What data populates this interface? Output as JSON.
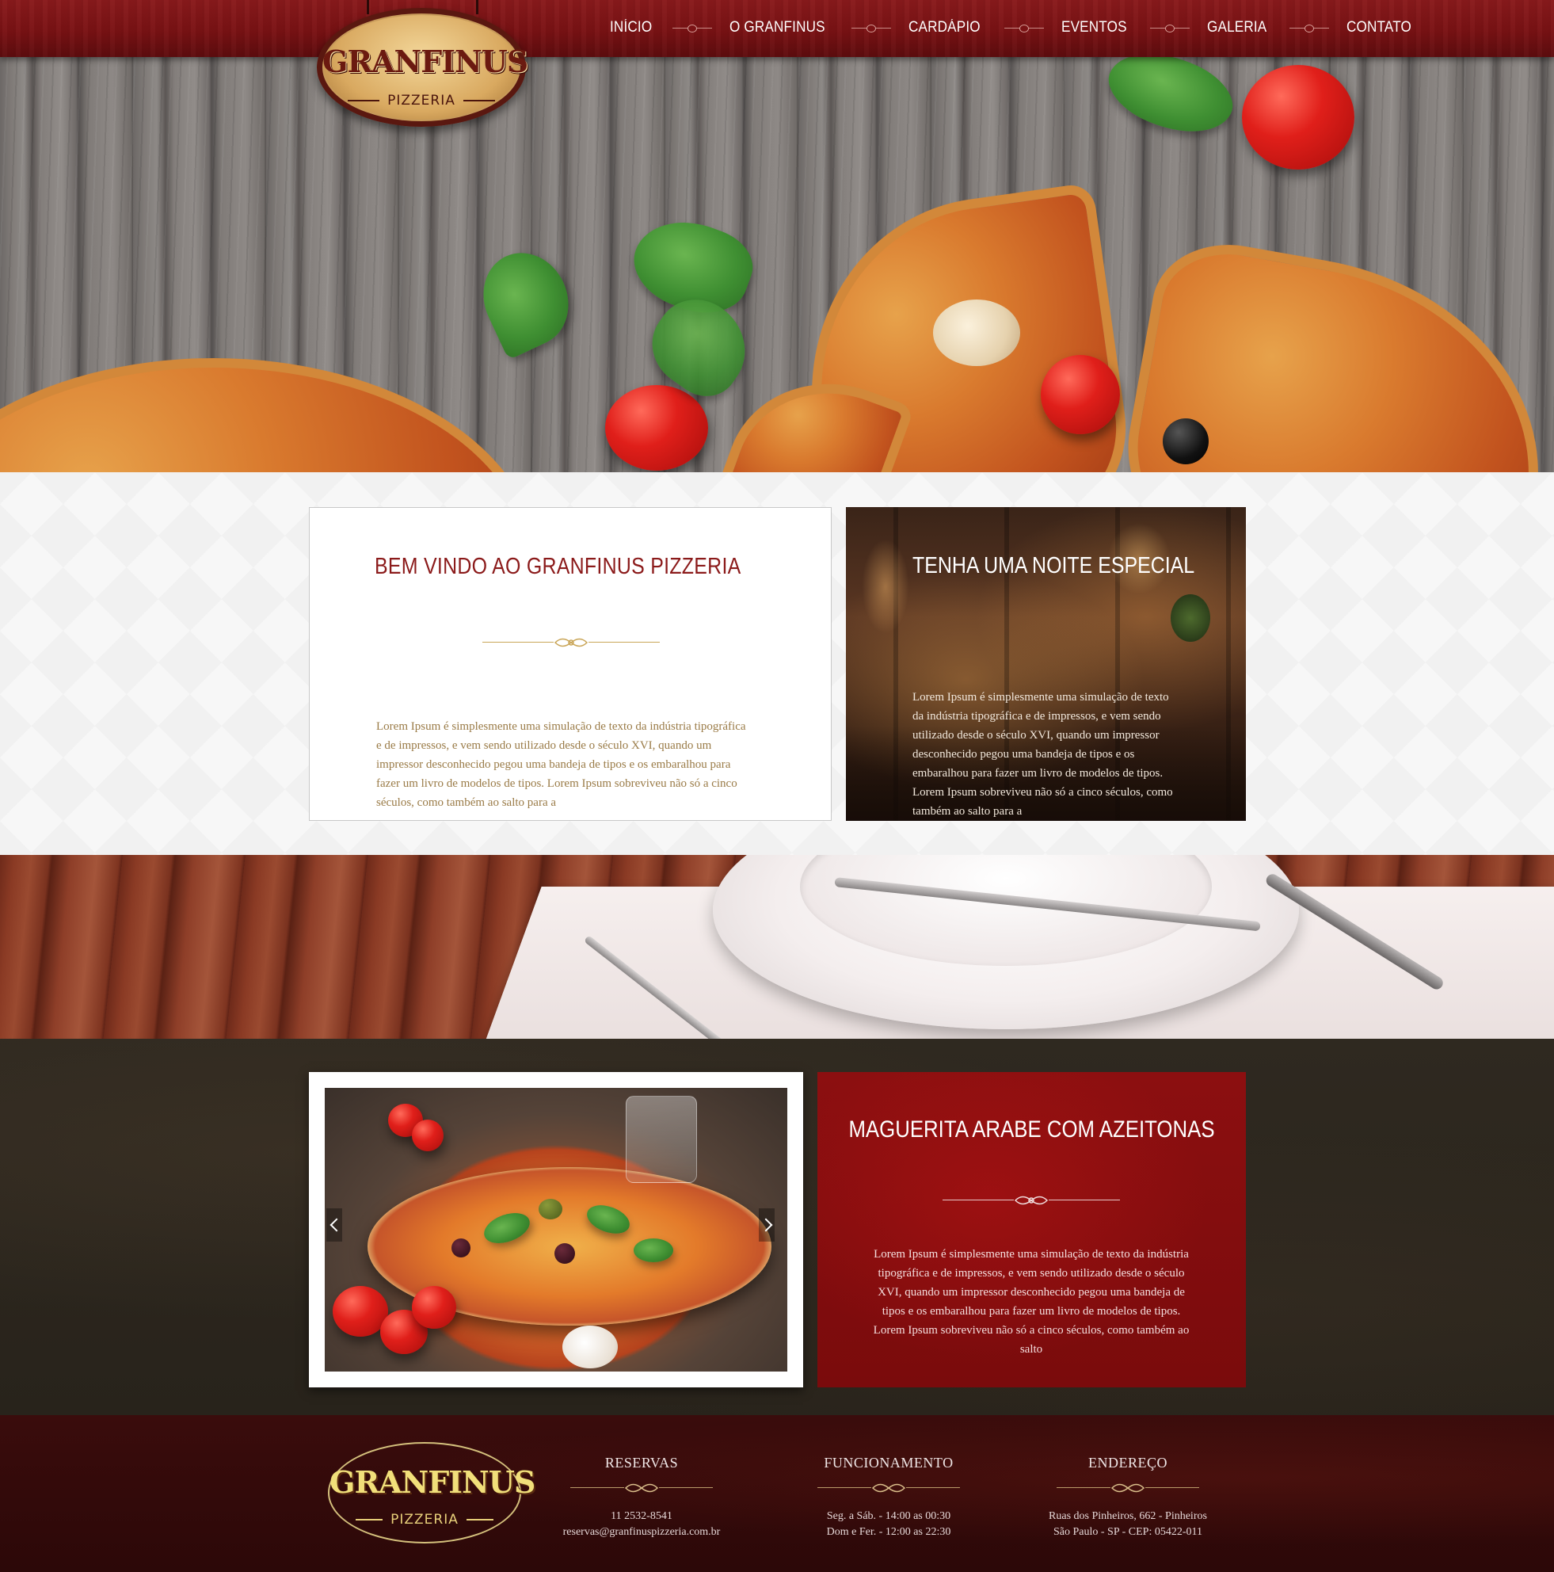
{
  "brand": {
    "logo_word": "GRANFINUS",
    "logo_sub": "PIZZERIA"
  },
  "nav": {
    "items": [
      {
        "label": "INÍCIO"
      },
      {
        "label": "O GRANFINUS"
      },
      {
        "label": "CARDÁPIO"
      },
      {
        "label": "EVENTOS"
      },
      {
        "label": "GALERIA"
      },
      {
        "label": "CONTATO"
      }
    ]
  },
  "welcome": {
    "title": "BEM VINDO AO GRANFINUS PIZZERIA",
    "text": "Lorem Ipsum é simplesmente uma simulação de texto da indústria tipográfica e de impressos, e vem sendo utilizado desde o século XVI, quando um impressor desconhecido pegou uma bandeja de tipos e os embaralhou para fazer um livro de modelos de tipos. Lorem Ipsum sobreviveu não só a cinco séculos, como também ao salto para a"
  },
  "special": {
    "title": "TENHA UMA NOITE ESPECIAL",
    "text": "Lorem Ipsum é simplesmente uma simulação de texto da indústria tipográfica e de impressos, e vem sendo utilizado desde o século XVI, quando um impressor desconhecido pegou uma bandeja de tipos e os embaralhou para fazer um livro de modelos de tipos. Lorem Ipsum sobreviveu não só a cinco séculos, como também ao salto para a"
  },
  "feature": {
    "title": "MAGUERITA ARABE COM AZEITONAS",
    "text": "Lorem Ipsum é simplesmente uma simulação de texto da indústria tipográfica e de impressos, e vem sendo utilizado desde o século XVI, quando um impressor desconhecido pegou uma bandeja de tipos e os embaralhou para fazer um livro de modelos de tipos. Lorem Ipsum sobreviveu não só a cinco séculos, como também ao salto"
  },
  "footer": {
    "reservas": {
      "title": "RESERVAS",
      "line1": "11 2532-8541",
      "line2": "reservas@granfinuspizzeria.com.br"
    },
    "funcionamento": {
      "title": "FUNCIONAMENTO",
      "line1": "Seg. a Sáb. - 14:00 as 00:30",
      "line2": "Dom e Fer. - 12:00 as 22:30"
    },
    "endereco": {
      "title": "ENDEREÇO",
      "line1": "Ruas dos Pinheiros, 662 - Pinheiros",
      "line2": "São Paulo - SP - CEP: 05422-011"
    }
  },
  "colors": {
    "header_red": "#7a1214",
    "title_red": "#8b1a1a",
    "body_gold": "#9a7b47",
    "feature_red": "#8c0f10",
    "footer_dark": "#3a0c0c"
  }
}
